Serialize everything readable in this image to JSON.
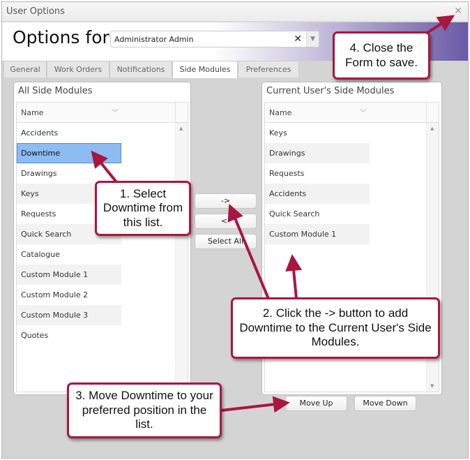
{
  "window": {
    "title": "User Options",
    "close_icon": "close-icon"
  },
  "header": {
    "options_for": "Options for",
    "user_value": "Administrator Admin",
    "clear": "✕",
    "dropdown": "▼"
  },
  "tabs": [
    "General",
    "Work Orders",
    "Notifications",
    "Side Modules",
    "Preferences"
  ],
  "active_tab": "Side Modules",
  "left_panel": {
    "title": "All Side Modules",
    "column": "Name",
    "items": [
      "Accidents",
      "Downtime",
      "Drawings",
      "Keys",
      "Requests",
      "Quick Search",
      "Catalogue",
      "Custom Module 1",
      "Custom Module 2",
      "Custom Module 3",
      "Quotes"
    ],
    "selected": "Downtime"
  },
  "right_panel": {
    "title": "Current User's Side Modules",
    "column": "Name",
    "items": [
      "Keys",
      "Drawings",
      "Requests",
      "Accidents",
      "Quick Search",
      "Custom Module 1"
    ]
  },
  "buttons": {
    "add": "->",
    "remove": "<-",
    "select_all": "Select All",
    "move_up": "Move Up",
    "move_down": "Move Down"
  },
  "callouts": {
    "c1": "1. Select Downtime from this list.",
    "c2": "2. Click the -> button to add Downtime to the Current User's Side Modules.",
    "c3": "3. Move Downtime to your preferred position in the list.",
    "c4": "4. Close the Form to save."
  },
  "colors": {
    "callout_border": "#a8173f",
    "selection": "#8cbcf2",
    "header_accent": "#6a5aa6"
  }
}
